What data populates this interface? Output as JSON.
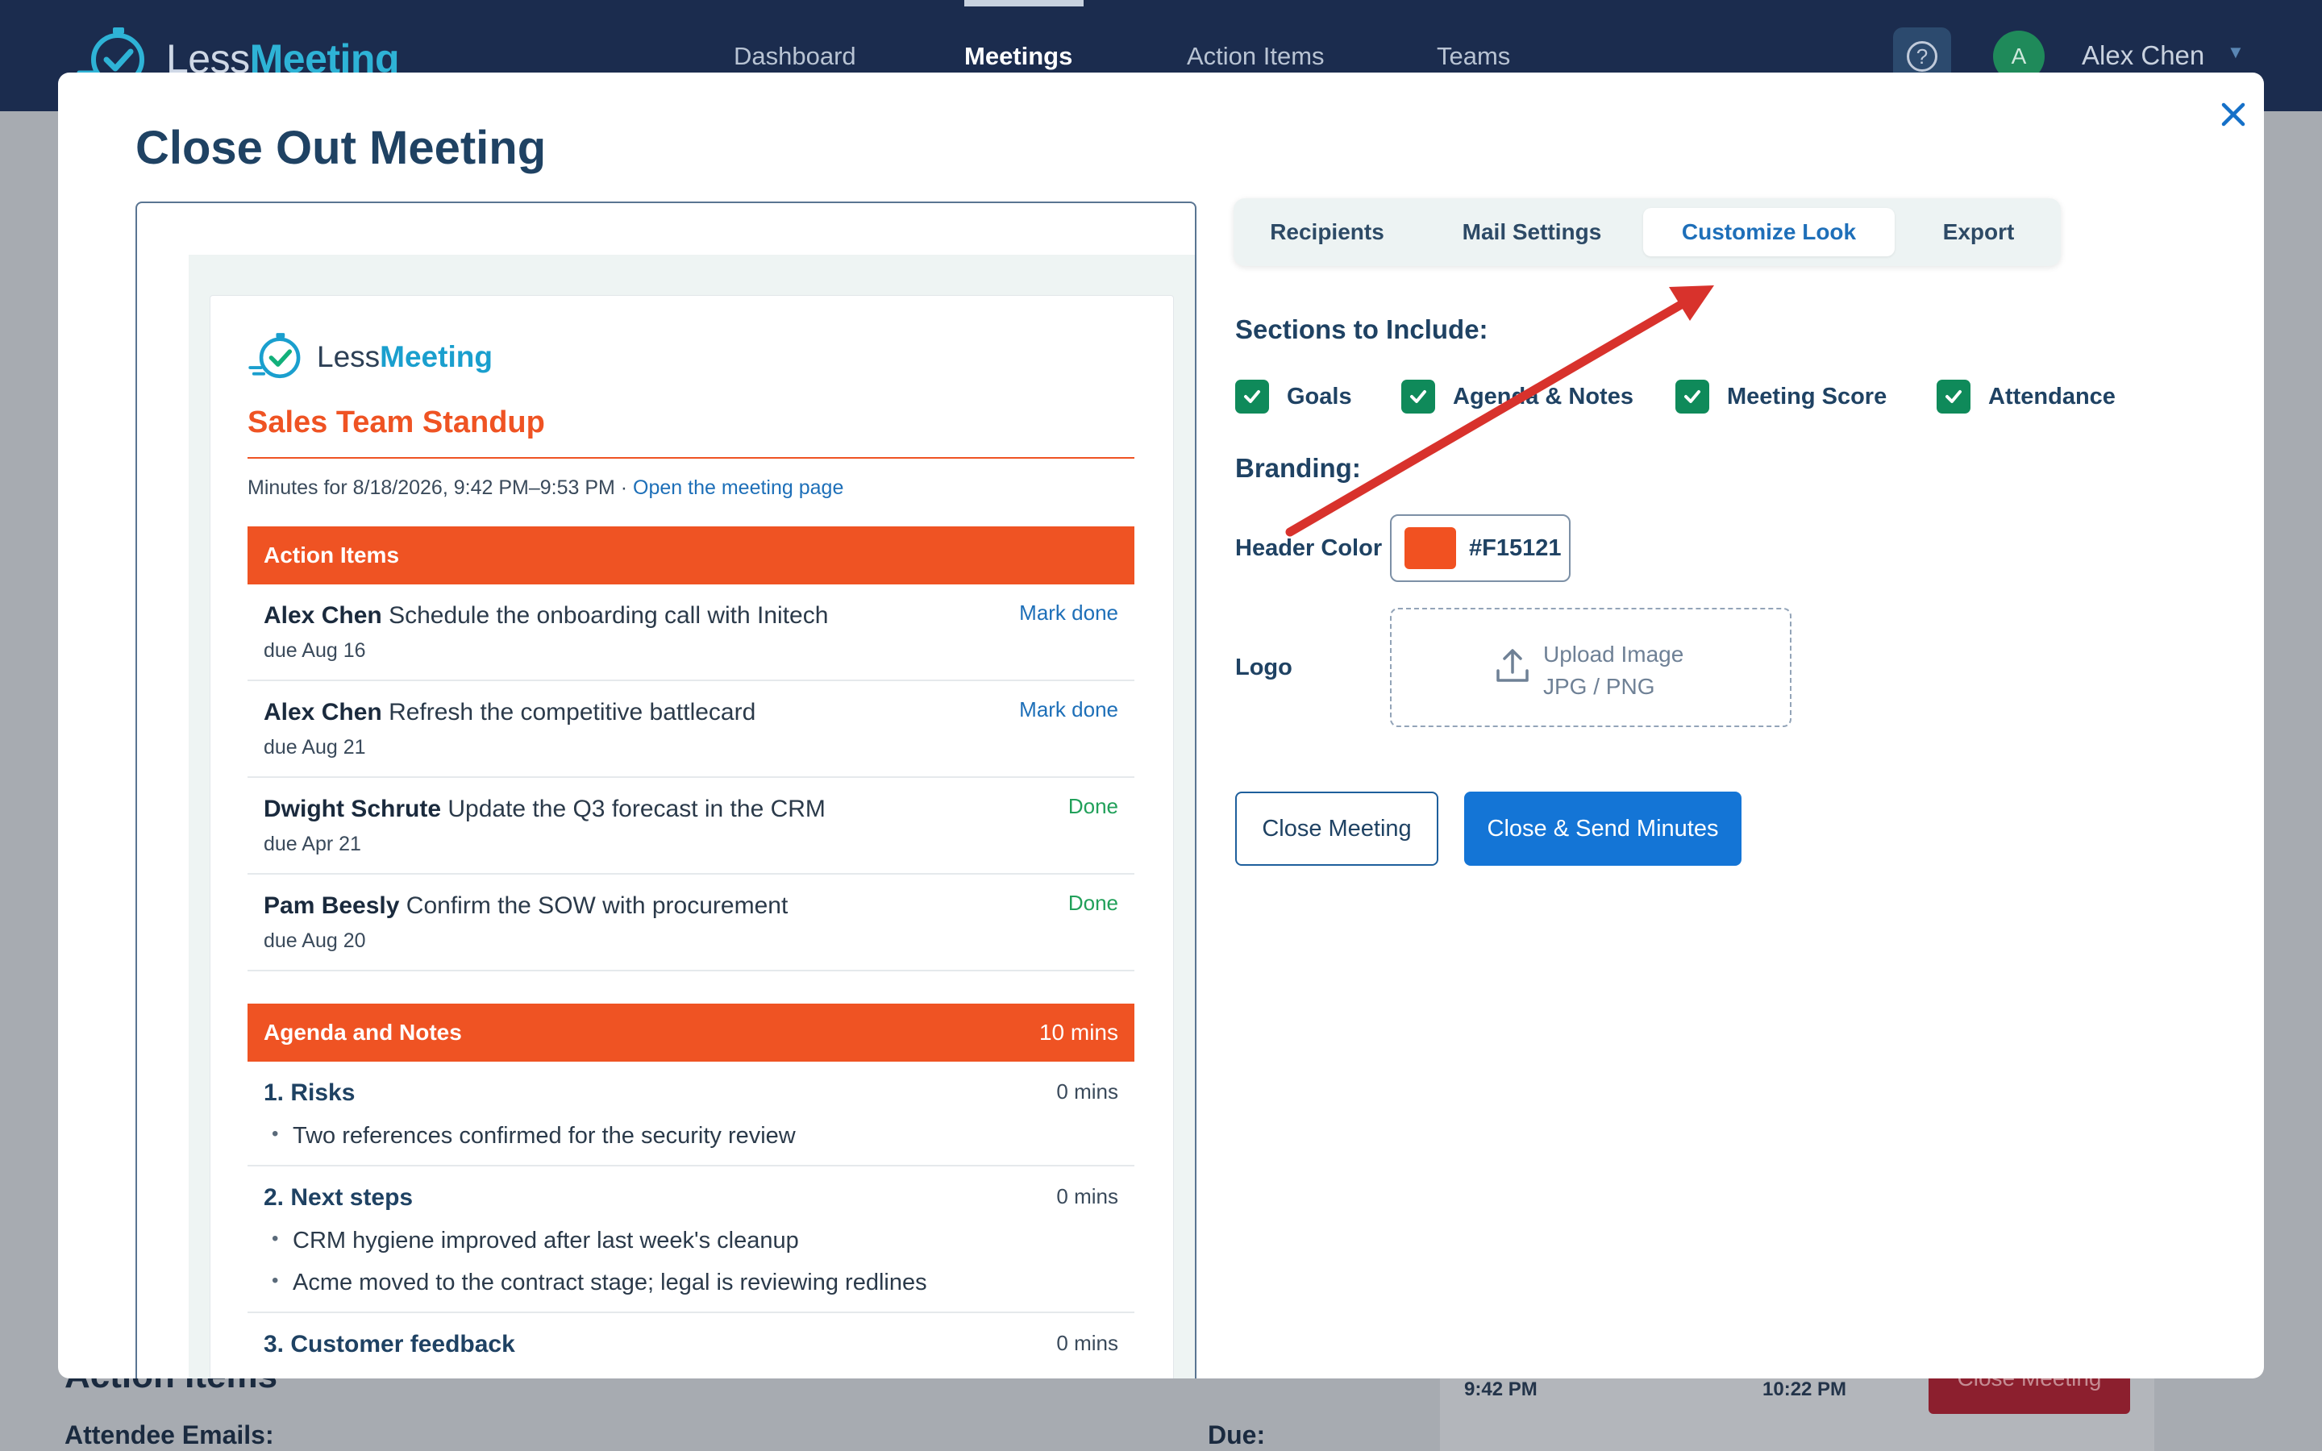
{
  "app": {
    "brand_light": "Less",
    "brand_bold": "Meeting",
    "nav": [
      "Dashboard",
      "Meetings",
      "Action Items",
      "Teams"
    ],
    "active_nav": "Meetings",
    "help_glyph": "?",
    "avatar_initial": "A",
    "user_name": "Alex Chen"
  },
  "background_page": {
    "heading": "Action Items",
    "attendee_emails_label": "Attendee Emails:",
    "due_label": "Due:",
    "start_time": "9:42 PM",
    "end_time": "10:22 PM",
    "close_button": "Close Meeting"
  },
  "modal": {
    "title": "Close Out Meeting",
    "preview": {
      "brand_light": "Less",
      "brand_bold": "Meeting",
      "meeting_title": "Sales Team Standup",
      "minutes_text": "Minutes for 8/18/2026, 9:42 PM–9:53 PM · ",
      "open_link": "Open the meeting page",
      "action_items_header": "Action Items",
      "action_items": [
        {
          "owner": "Alex Chen",
          "task": "Schedule the onboarding call with Initech",
          "due": "due Aug 16",
          "status": "Mark done",
          "status_kind": "link"
        },
        {
          "owner": "Alex Chen",
          "task": "Refresh the competitive battlecard",
          "due": "due Aug 21",
          "status": "Mark done",
          "status_kind": "link"
        },
        {
          "owner": "Dwight Schrute",
          "task": "Update the Q3 forecast in the CRM",
          "due": "due Apr 21",
          "status": "Done",
          "status_kind": "done"
        },
        {
          "owner": "Pam Beesly",
          "task": "Confirm the SOW with procurement",
          "due": "due Aug 20",
          "status": "Done",
          "status_kind": "done"
        }
      ],
      "agenda_header": "Agenda and Notes",
      "agenda_total": "10 mins",
      "agenda": [
        {
          "title": "1. Risks",
          "mins": "0 mins",
          "notes": [
            "Two references confirmed for the security review"
          ]
        },
        {
          "title": "2. Next steps",
          "mins": "0 mins",
          "notes": [
            "CRM hygiene improved after last week's cleanup",
            "Acme moved to the contract stage; legal is reviewing redlines"
          ]
        },
        {
          "title": "3. Customer feedback",
          "mins": "0 mins",
          "notes": []
        }
      ]
    },
    "tabs": [
      "Recipients",
      "Mail Settings",
      "Customize Look",
      "Export"
    ],
    "active_tab": "Customize Look",
    "sections_label": "Sections to Include:",
    "sections": [
      {
        "label": "Goals",
        "checked": true
      },
      {
        "label": "Agenda & Notes",
        "checked": true
      },
      {
        "label": "Meeting Score",
        "checked": true
      },
      {
        "label": "Attendance",
        "checked": true
      }
    ],
    "branding_label": "Branding:",
    "header_color_label": "Header Color",
    "header_color_value": "#F15121",
    "logo_label": "Logo",
    "upload_line1": "Upload Image",
    "upload_line2": "JPG / PNG",
    "close_button": "Close Meeting",
    "send_button": "Close & Send Minutes"
  },
  "colors": {
    "header_orange": "#EF5323",
    "navy": "#1B2C4E",
    "primary_blue": "#1475D6",
    "check_green": "#0F8A5A",
    "annotation_red": "#D8322C"
  },
  "icons": [
    "logo-clock-check-icon",
    "help-icon",
    "chevron-down-icon",
    "close-icon",
    "checkmark-icon",
    "upload-icon"
  ]
}
